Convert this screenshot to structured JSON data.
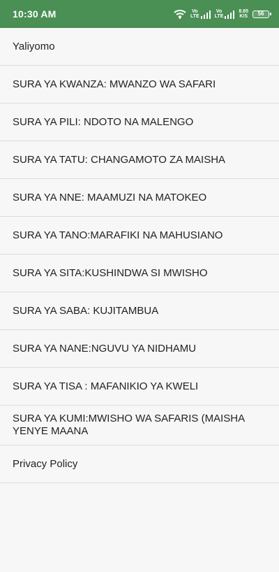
{
  "status_bar": {
    "time": "10:30 AM",
    "network_1": "Vo\nLTE",
    "network_2": "Vo\nLTE",
    "speed": "8.65\nK/S",
    "battery": "56",
    "accent": "#4a8f54"
  },
  "menu": {
    "items": [
      {
        "label": "Yaliyomo"
      },
      {
        "label": "SURA YA KWANZA: MWANZO WA SAFARI"
      },
      {
        "label": "SURA YA PILI: NDOTO NA MALENGO"
      },
      {
        "label": "SURA YA TATU: CHANGAMOTO ZA MAISHA"
      },
      {
        "label": "SURA YA NNE: MAAMUZI NA MATOKEO"
      },
      {
        "label": "SURA YA TANO:MARAFIKI NA MAHUSIANO"
      },
      {
        "label": "SURA YA SITA:KUSHINDWA SI MWISHO"
      },
      {
        "label": "SURA YA SABA: KUJITAMBUA"
      },
      {
        "label": "SURA YA NANE:NGUVU YA NIDHAMU"
      },
      {
        "label": "SURA YA TISA : MAFANIKIO YA KWELI"
      },
      {
        "label": "SURA YA KUMI:MWISHO WA SAFARIS (MAISHA YENYE MAANA"
      },
      {
        "label": "Privacy Policy"
      }
    ]
  }
}
